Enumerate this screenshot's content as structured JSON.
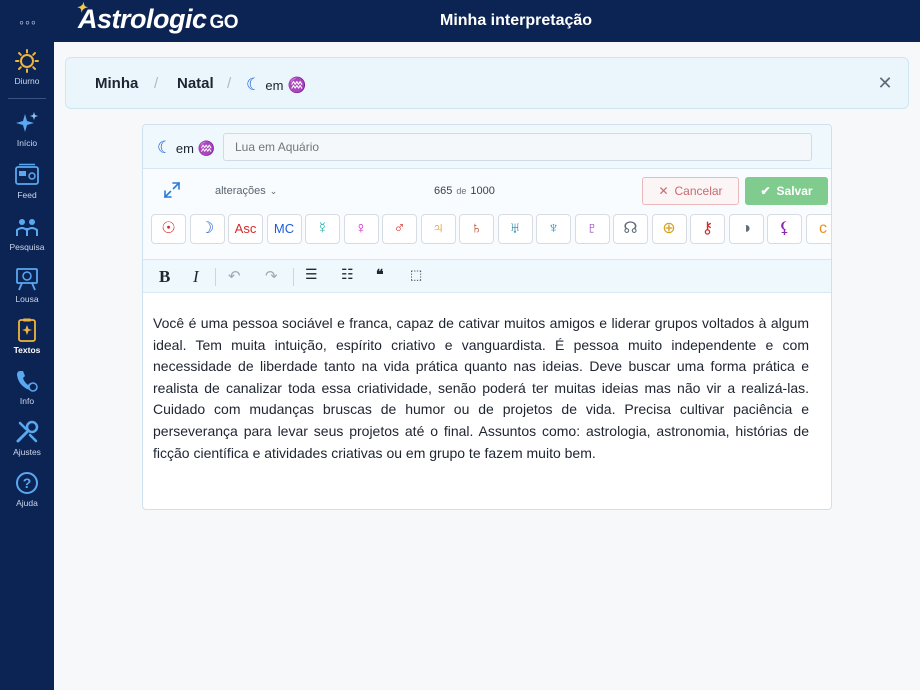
{
  "app": {
    "menu_icon": "dots-icon",
    "logo_text": "Astrologic",
    "logo_suffix": "GO",
    "page_title": "Minha interpretação"
  },
  "sidebar": {
    "items": [
      {
        "label": "Diurno",
        "icon": "sun-icon"
      },
      {
        "label": "Início",
        "icon": "sparkles-icon"
      },
      {
        "label": "Feed",
        "icon": "feed-icon"
      },
      {
        "label": "Pesquisa",
        "icon": "research-icon"
      },
      {
        "label": "Lousa",
        "icon": "board-icon"
      },
      {
        "label": "Textos",
        "icon": "texts-icon",
        "active": true
      },
      {
        "label": "Info",
        "icon": "info-icon"
      },
      {
        "label": "Ajustes",
        "icon": "settings-icon"
      },
      {
        "label": "Ajuda",
        "icon": "help-icon"
      }
    ]
  },
  "breadcrumb": {
    "items": [
      "Minha",
      "Natal"
    ],
    "current_moon": "☾",
    "current_em": "em",
    "current_sign": "♒",
    "separator": "/"
  },
  "editor": {
    "header_moon": "☾",
    "header_em": "em",
    "header_sign": "♒",
    "title_placeholder": "Lua em Aquário",
    "changes_label": "alterações",
    "count_current": "665",
    "count_of": "de",
    "count_max": "1000",
    "cancel_label": "Cancelar",
    "save_label": "Salvar",
    "glyphs": [
      {
        "symbol": "☉",
        "color": "#d42a2a",
        "name": "sun-glyph"
      },
      {
        "symbol": "☽",
        "color": "#1f5fd6",
        "name": "moon-glyph"
      },
      {
        "symbol": "Asc",
        "color": "#d42a2a",
        "name": "ascendant-glyph"
      },
      {
        "symbol": "MC",
        "color": "#1f5fd6",
        "name": "midheaven-glyph"
      },
      {
        "symbol": "☿",
        "color": "#1ab0a8",
        "name": "mercury-glyph"
      },
      {
        "symbol": "♀",
        "color": "#d21fc4",
        "name": "venus-glyph"
      },
      {
        "symbol": "♂",
        "color": "#d42a2a",
        "name": "mars-glyph"
      },
      {
        "symbol": "♃",
        "color": "#e8901f",
        "name": "jupiter-glyph"
      },
      {
        "symbol": "♄",
        "color": "#b8432a",
        "name": "saturn-glyph"
      },
      {
        "symbol": "♅",
        "color": "#1a7f9a",
        "name": "uranus-glyph"
      },
      {
        "symbol": "♆",
        "color": "#1f8fd6",
        "name": "neptune-glyph"
      },
      {
        "symbol": "♇",
        "color": "#8a2ab0",
        "name": "pluto-glyph"
      },
      {
        "symbol": "☊",
        "color": "#606a78",
        "name": "node-glyph"
      },
      {
        "symbol": "⊕",
        "color": "#d4a020",
        "name": "fortune-glyph"
      },
      {
        "symbol": "⚷",
        "color": "#d42a2a",
        "name": "chiron-glyph"
      },
      {
        "symbol": "◑",
        "color": "#606a78",
        "name": "lilith-glyph"
      },
      {
        "symbol": "⚸",
        "color": "#8a2ab0",
        "name": "black-moon-glyph"
      },
      {
        "symbol": "c",
        "color": "#e8901f",
        "name": "ceres-glyph"
      }
    ],
    "format": {
      "bold": "B",
      "italic": "I",
      "undo": "↶",
      "redo": "↷",
      "bullets": "☰",
      "numbered": "☷",
      "quote": "❝",
      "clear": "⬚"
    },
    "body": "Você é uma pessoa sociável e franca, capaz de cativar muitos amigos e liderar grupos voltados à algum ideal. Tem muita intuição, espírito criativo e vanguardista. É pessoa muito independente e com necessidade de liberdade tanto na vida prática quanto nas ideias. Deve buscar uma forma prática e realista de canalizar toda essa criatividade, senão poderá ter muitas ideias mas não vir a realizá-las. Cuidado com mudanças bruscas de humor ou de projetos de vida. Precisa cultivar paciência e perseverança para levar seus projetos até o final. Assuntos como: astrologia, astronomia, histórias de ficção científica e atividades criativas ou em grupo te fazem muito bem."
  },
  "colors": {
    "navy": "#0c2454",
    "accent_blue": "#1f5fd6",
    "save_green": "#7fcc8e",
    "cancel_red": "#c96a70",
    "sidebar_icon": "#f0b43c"
  }
}
